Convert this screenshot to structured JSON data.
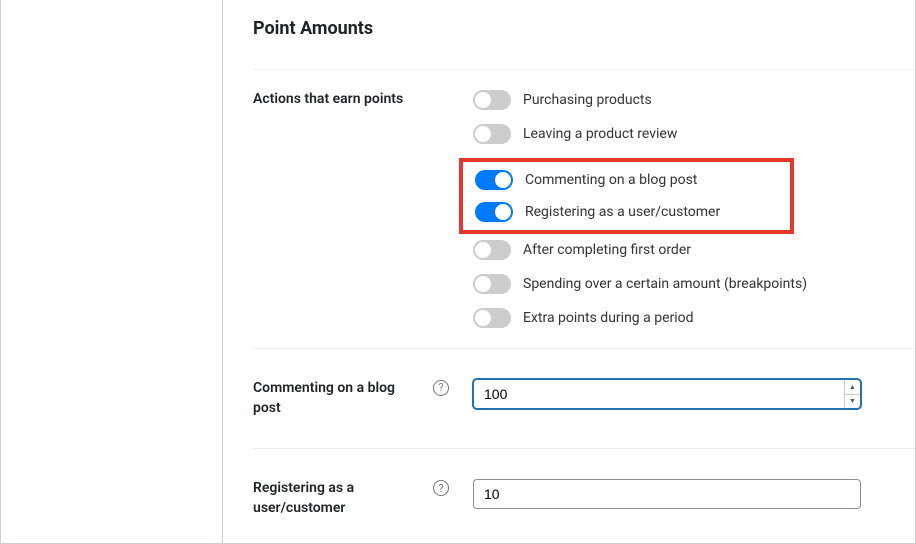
{
  "heading": "Point Amounts",
  "actions": {
    "label": "Actions that earn points",
    "items": [
      {
        "label": "Purchasing products",
        "enabled": false
      },
      {
        "label": "Leaving a product review",
        "enabled": false
      },
      {
        "label": "Commenting on a blog post",
        "enabled": true
      },
      {
        "label": "Registering as a user/customer",
        "enabled": true
      },
      {
        "label": "After completing first order",
        "enabled": false
      },
      {
        "label": "Spending over a certain amount (breakpoints)",
        "enabled": false
      },
      {
        "label": "Extra points during a period",
        "enabled": false
      }
    ]
  },
  "commenting": {
    "label": "Commenting on a blog post",
    "value": "100"
  },
  "registering": {
    "label": "Registering as a user/customer",
    "value": "10"
  }
}
